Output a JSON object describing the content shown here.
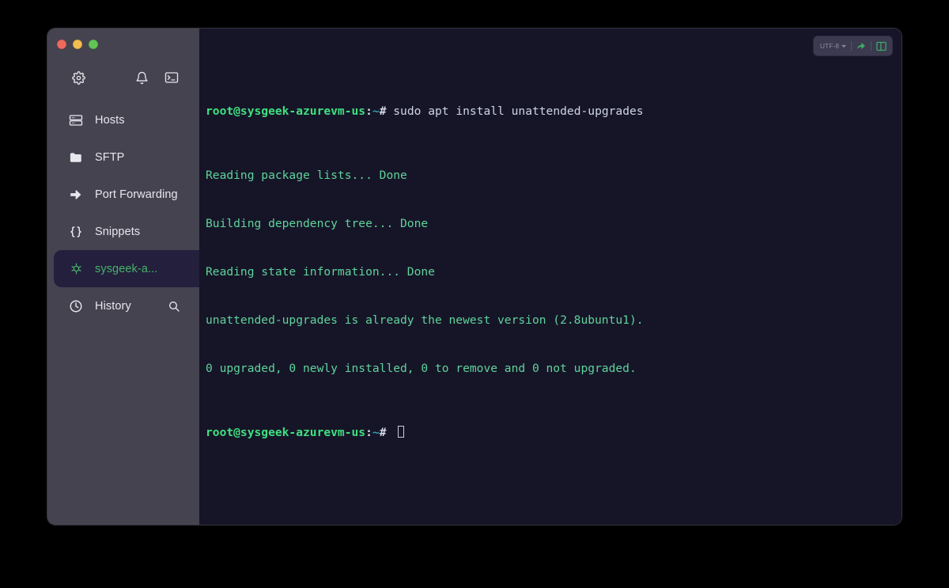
{
  "window": {
    "traffic_lights": [
      {
        "name": "close",
        "color": "#ef6a5e"
      },
      {
        "name": "minimize",
        "color": "#f4bd4f"
      },
      {
        "name": "maximize",
        "color": "#61c554"
      }
    ]
  },
  "sidebar": {
    "top_icons": [
      {
        "name": "gear-icon",
        "label": "Settings"
      },
      {
        "name": "bell-icon",
        "label": "Notifications"
      },
      {
        "name": "terminal-icon",
        "label": "New Terminal"
      }
    ],
    "items": [
      {
        "label": "Hosts",
        "icon": "server-rack-icon",
        "active": false
      },
      {
        "label": "SFTP",
        "icon": "folder-icon",
        "active": false
      },
      {
        "label": "Port Forwarding",
        "icon": "arrow-right-icon",
        "active": false
      },
      {
        "label": "Snippets",
        "icon": "braces-icon",
        "active": false
      },
      {
        "label": "sysgeek-a...",
        "icon": "session-icon",
        "active": true
      },
      {
        "label": "History",
        "icon": "clock-icon",
        "active": false,
        "trailing_icon": "search-icon"
      }
    ]
  },
  "terminal": {
    "toolbar": {
      "encoding_label": "UTF-8",
      "share_icon": "share-arrow-icon",
      "split_icon": "split-panel-icon"
    },
    "prompt": {
      "user_host": "root@sysgeek-azurevm-us",
      "colon": ":",
      "path": "~",
      "symbol": "# "
    },
    "lines": [
      {
        "type": "prompt",
        "command": "sudo apt install unattended-upgrades"
      },
      {
        "type": "output",
        "text": "Reading package lists... Done"
      },
      {
        "type": "output",
        "text": "Building dependency tree... Done"
      },
      {
        "type": "output",
        "text": "Reading state information... Done"
      },
      {
        "type": "output",
        "text": "unattended-upgrades is already the newest version (2.8ubuntu1)."
      },
      {
        "type": "output",
        "text": "0 upgraded, 0 newly installed, 0 to remove and 0 not upgraded."
      },
      {
        "type": "prompt",
        "command": ""
      }
    ]
  },
  "colors": {
    "background": "#000000",
    "sidebar": "#454350",
    "terminal_bg": "#161528",
    "accent_green": "#46b36a",
    "active_item_bg": "#241f3d",
    "output_green": "#5fd39a"
  }
}
